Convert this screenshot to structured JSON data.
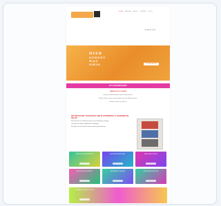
{
  "site": {
    "nav": [
      "HOME",
      "SERVICE",
      "ABOUT",
      "CONTACT",
      "BLOG"
    ],
    "phone": "+32 488 76 24 38",
    "hero_lines": [
      "HIER",
      "STREET",
      "WAS",
      "OHIN"
    ],
    "hero_button": "NU AANVRAGEN",
    "band_text": "NU AANVRAGEN!",
    "intro_heading": "WAAROM ZOU U KIEZEN",
    "intro_lines": [
      "Wij zijn een professioneel team in straatreclame.",
      "Neem contact op voor meer informatie en een offerte op maat.",
      "Bel ons of stuur een bericht."
    ],
    "section_heading": "WAT BIETEN WIJ: STRAATRECLAME IN ANTWERPEN, VLAANDEREN EN BELGIE",
    "section_lines": [
      "Straatreclame is een effectieve manier om uw boodschap te brengen.",
      "Onze diensten worden aangeboden in heel Belgie.",
      "Wij zorgen voor een snelle levering en professionele plaatsing."
    ],
    "tiles": [
      "AFFICHES IN ANTWERPEN",
      "AFFICHES IN BRUSSEL",
      "AFFICHES IN GENT",
      "AFFICHES IN KORTRIJK",
      "AFFICHES IN LEUVEN",
      "AFFICHES IN BRUGGE"
    ],
    "wide_tile": "STRAATRECLAME IN BELGIE"
  }
}
